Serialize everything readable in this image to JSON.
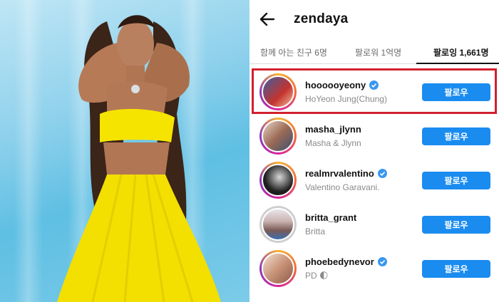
{
  "header": {
    "back_icon": "arrow-left-icon",
    "username": "zendaya"
  },
  "tabs": [
    {
      "label": "함께 아는 친구 6명",
      "active": false
    },
    {
      "label": "팔로워 1억명",
      "active": false
    },
    {
      "label": "팔로잉 1,661명",
      "active": true
    }
  ],
  "follow_label": "팔로우",
  "accounts": [
    {
      "handle": "hoooooyeony",
      "verified": true,
      "name": "HoYeon Jung(Chung)",
      "story_ring": true,
      "highlighted": true
    },
    {
      "handle": "masha_jlynn",
      "verified": false,
      "name": "Masha & Jlynn",
      "story_ring": true,
      "highlighted": false
    },
    {
      "handle": "realmrvalentino",
      "verified": true,
      "name": "Valentino Garavani.",
      "story_ring": true,
      "highlighted": false
    },
    {
      "handle": "britta_grant",
      "verified": false,
      "name": "Britta",
      "story_ring": false,
      "highlighted": false
    },
    {
      "handle": "phoebedynevor",
      "verified": true,
      "name": "PD 🌓",
      "story_ring": true,
      "highlighted": false
    }
  ],
  "colors": {
    "follow_button": "#1a8cf0",
    "verified_badge": "#3897f0",
    "highlight_box": "#d2202f",
    "photo_background": "#7ccbe9",
    "dress": "#f5e400"
  }
}
